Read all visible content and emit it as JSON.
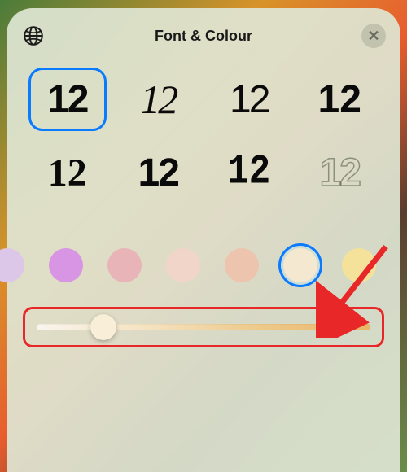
{
  "header": {
    "title": "Font & Colour"
  },
  "fontSample": "12",
  "fonts": {
    "options": [
      {
        "style": "f1",
        "selected": true
      },
      {
        "style": "f2",
        "selected": false
      },
      {
        "style": "f3",
        "selected": false
      },
      {
        "style": "f4",
        "selected": false
      },
      {
        "style": "f5",
        "selected": false
      },
      {
        "style": "f6",
        "selected": false
      },
      {
        "style": "f7",
        "selected": false
      },
      {
        "style": "f8",
        "selected": false
      }
    ]
  },
  "colors": {
    "swatches": [
      {
        "color": "#dcc7e8",
        "selected": false
      },
      {
        "color": "#d895e4",
        "selected": false
      },
      {
        "color": "#e8b4b8",
        "selected": false
      },
      {
        "color": "#f0d5c8",
        "selected": false
      },
      {
        "color": "#edc4ae",
        "selected": false
      },
      {
        "color": "#f5e8d0",
        "selected": true
      },
      {
        "color": "#f4e29b",
        "selected": false
      }
    ]
  },
  "slider": {
    "value": 20
  }
}
